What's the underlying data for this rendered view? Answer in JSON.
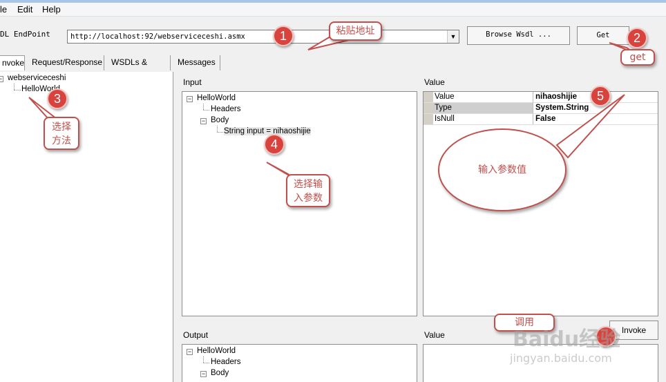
{
  "menu": {
    "file": "le",
    "edit": "Edit",
    "help": "Help"
  },
  "endpoint": {
    "label": "DL EndPoint",
    "url": "http://localhost:92/webserviceceshi.asmx"
  },
  "buttons": {
    "browse": "Browse Wsdl ...",
    "get": "Get",
    "invoke": "Invoke"
  },
  "tabs": [
    "nvoke",
    "Request/Response",
    "WSDLs & Proxy",
    "Messages"
  ],
  "left_tree": {
    "root": "webserviceceshi",
    "child": "HelloWorld"
  },
  "input": {
    "label": "Input",
    "root": "HelloWorld",
    "headers": "Headers",
    "body": "Body",
    "param": "String input = nihaoshijie"
  },
  "value_panel": {
    "label": "Value",
    "rows": [
      {
        "name": "Value",
        "value": "nihaoshijie"
      },
      {
        "name": "Type",
        "value": "System.String"
      },
      {
        "name": "IsNull",
        "value": "False"
      }
    ]
  },
  "output": {
    "label": "Output",
    "root": "HelloWorld",
    "headers": "Headers",
    "body": "Body"
  },
  "output_value": {
    "label": "Value"
  },
  "annotations": {
    "n1": "1",
    "n2": "2",
    "n3": "3",
    "n4": "4",
    "n5": "5",
    "paste_address": "粘贴地址",
    "get": "get",
    "select_method": "选择\n方法",
    "select_param": "选择输\n入参数",
    "enter_value": "输入参数值",
    "invoke_call": "调用"
  },
  "watermark": {
    "brand": "Baidu经验",
    "url": "jingyan.baidu.com"
  },
  "colors": {
    "annotation_red": "#d9433d",
    "callout_border": "#c0504d"
  }
}
